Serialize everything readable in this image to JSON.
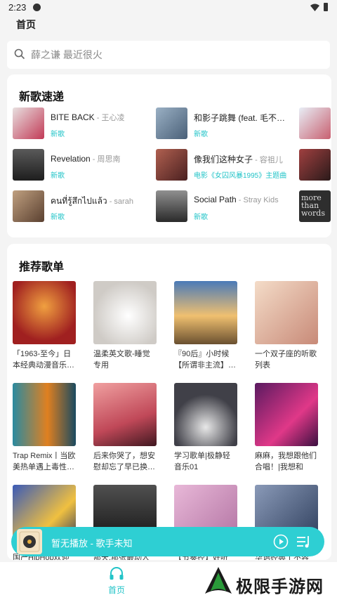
{
  "status": {
    "time": "2:23"
  },
  "header": {
    "title": "首页"
  },
  "search": {
    "placeholder": "薛之谦 最近很火"
  },
  "new_songs": {
    "title": "新歌速递",
    "items": [
      {
        "title": "BITE BACK",
        "artist": " - 王心凌",
        "tag": "新歌",
        "color": "#c23a56"
      },
      {
        "title": "和影子跳舞 (feat. 毛不…",
        "artist": "",
        "tag": "新歌",
        "color": "#6c8aa6"
      },
      {
        "title": "Revelation",
        "artist": " - 周思南",
        "tag": "新歌",
        "color": "#3a3a3a"
      },
      {
        "title": "像我们这种女子",
        "artist": " - 容祖儿",
        "tag": "电影《女囚风暴1995》主题曲",
        "color": "#7a3a3a"
      },
      {
        "title": "คนที่รู้สึกไปแล้ว",
        "artist": " - sarah",
        "tag": "新歌",
        "color": "#8a6a4a"
      },
      {
        "title": "Social Path",
        "artist": " - Stray Kids",
        "tag": "新歌",
        "color": "#4a4a4a"
      }
    ],
    "side_thumb_text": "more than words"
  },
  "recommend": {
    "title": "推荐歌单",
    "items": [
      {
        "title": "「1963-至今」日本经典动漫音乐…",
        "color": "#c8423a"
      },
      {
        "title": "温柔英文歌-睡觉专用",
        "color": "#d8d4d0"
      },
      {
        "title": "『90后』小时候【所谓非主流】…",
        "color": "#e8a050"
      },
      {
        "title": "一个双子座的听歌列表",
        "color": "#f0c8b8"
      },
      {
        "title": "Trap Remix丨当欧美热单遇上毒性…",
        "color": "#2a8aa0"
      },
      {
        "title": "后来你哭了，想安慰却忘了早已换…",
        "color": "#c05050"
      },
      {
        "title": "学习歌单|极静轻音乐01",
        "color": "#404048"
      },
      {
        "title": "麻麻，我想跟他们合唱！|我想和你…",
        "color": "#a02878"
      },
      {
        "title": "国产HipHop欢迎",
        "color": "#2a3a80"
      },
      {
        "title": "那天,那张最动人的怀旧",
        "color": "#2a2a2a"
      },
      {
        "title": "【节奏控】好听又…",
        "color": "#c88ab8"
      },
      {
        "title": "华语经典丨不容错…",
        "color": "#4a5a7a"
      }
    ]
  },
  "mini_player": {
    "text": "暂无播放 - 歌手未知"
  },
  "nav": {
    "home": "首页"
  },
  "watermark": {
    "text": "极限手游网"
  },
  "theme": {
    "accent": "#2ecfd3"
  }
}
